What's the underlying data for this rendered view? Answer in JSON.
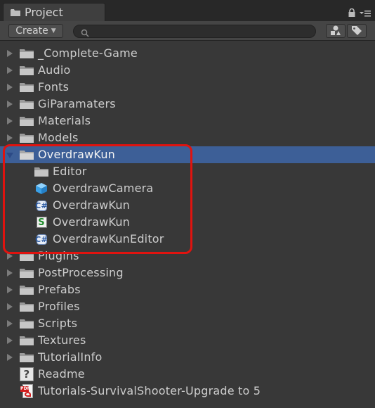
{
  "window": {
    "tab_title": "Project"
  },
  "toolbar": {
    "create_label": "Create",
    "search_placeholder": "",
    "search_value": ""
  },
  "colors": {
    "selection": "#3d5f97",
    "highlight_border": "#e0130f",
    "panel_bg": "#383838"
  },
  "tree": [
    {
      "label": "_Complete-Game",
      "type": "folder",
      "level": 0,
      "expandable": true
    },
    {
      "label": "Audio",
      "type": "folder",
      "level": 0,
      "expandable": true
    },
    {
      "label": "Fonts",
      "type": "folder",
      "level": 0,
      "expandable": true
    },
    {
      "label": "GiParamaters",
      "type": "folder",
      "level": 0,
      "expandable": true
    },
    {
      "label": "Materials",
      "type": "folder",
      "level": 0,
      "expandable": true
    },
    {
      "label": "Models",
      "type": "folder",
      "level": 0,
      "expandable": true
    },
    {
      "label": "OverdrawKun",
      "type": "folder",
      "level": 0,
      "expandable": true,
      "expanded": true,
      "selected": true
    },
    {
      "label": "Editor",
      "type": "folder",
      "level": 1
    },
    {
      "label": "OverdrawCamera",
      "type": "prefab",
      "level": 1
    },
    {
      "label": "OverdrawKun",
      "type": "csharp",
      "level": 1
    },
    {
      "label": "OverdrawKun",
      "type": "javascript",
      "level": 1
    },
    {
      "label": "OverdrawKunEditor",
      "type": "csharp",
      "level": 1
    },
    {
      "label": "Plugins",
      "type": "folder",
      "level": 0,
      "expandable": true
    },
    {
      "label": "PostProcessing",
      "type": "folder",
      "level": 0,
      "expandable": true
    },
    {
      "label": "Prefabs",
      "type": "folder",
      "level": 0,
      "expandable": true
    },
    {
      "label": "Profiles",
      "type": "folder",
      "level": 0,
      "expandable": true
    },
    {
      "label": "Scripts",
      "type": "folder",
      "level": 0,
      "expandable": true
    },
    {
      "label": "Textures",
      "type": "folder",
      "level": 0,
      "expandable": true
    },
    {
      "label": "TutorialInfo",
      "type": "folder",
      "level": 0,
      "expandable": true
    },
    {
      "label": "Readme",
      "type": "readme",
      "level": 0
    },
    {
      "label": "Tutorials-SurvivalShooter-Upgrade to 5",
      "type": "pdf",
      "level": 0
    }
  ]
}
